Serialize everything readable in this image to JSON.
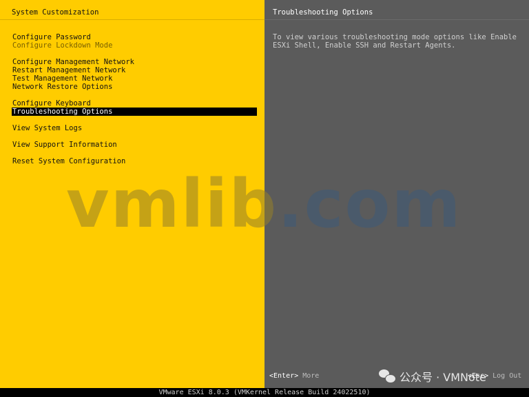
{
  "left_pane": {
    "title": "System Customization",
    "menu_groups": [
      [
        {
          "label": "Configure Password",
          "state": "normal"
        },
        {
          "label": "Configure Lockdown Mode",
          "state": "disabled"
        }
      ],
      [
        {
          "label": "Configure Management Network",
          "state": "normal"
        },
        {
          "label": "Restart Management Network",
          "state": "normal"
        },
        {
          "label": "Test Management Network",
          "state": "normal"
        },
        {
          "label": "Network Restore Options",
          "state": "normal"
        }
      ],
      [
        {
          "label": "Configure Keyboard",
          "state": "normal"
        },
        {
          "label": "Troubleshooting Options",
          "state": "selected"
        }
      ],
      [
        {
          "label": "View System Logs",
          "state": "normal"
        }
      ],
      [
        {
          "label": "View Support Information",
          "state": "normal"
        }
      ],
      [
        {
          "label": "Reset System Configuration",
          "state": "normal"
        }
      ]
    ],
    "background_color": "#ffcc00"
  },
  "right_pane": {
    "title": "Troubleshooting Options",
    "description": "To view various troubleshooting mode options like Enable\nESXi Shell, Enable SSH and Restart Agents.",
    "background_color": "#5b5b5b",
    "footer": {
      "enter_key": "<Enter>",
      "enter_action": "More",
      "esc_key": "<Esc>",
      "esc_action": "Log Out"
    }
  },
  "watermark": {
    "left_part": "vmlib",
    "right_part": ".com"
  },
  "overlay": {
    "icon": "wechat-icon",
    "text": "公众号 · VMNote"
  },
  "status_bar": {
    "text": "VMware ESXi 8.0.3 (VMKernel Release Build 24022510)"
  }
}
